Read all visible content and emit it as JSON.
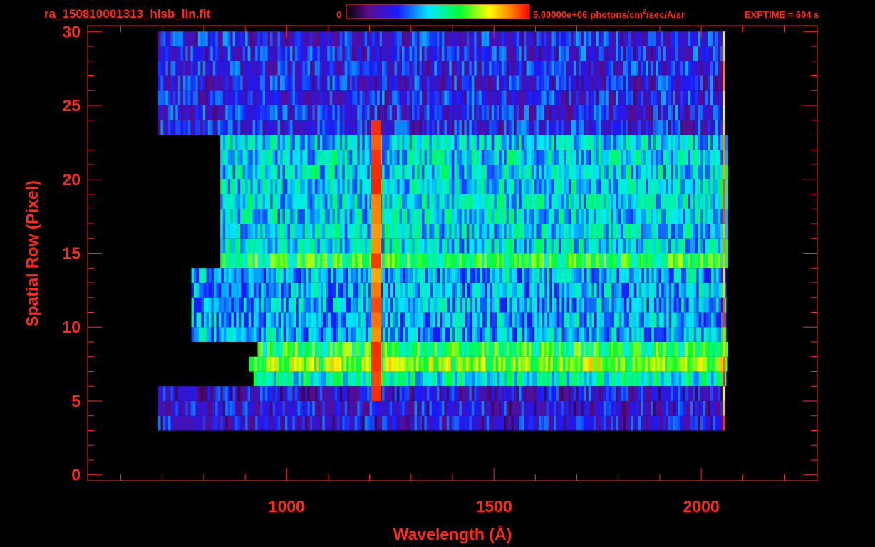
{
  "header": {
    "filename": "ra_150810001313_hisb_lin.fit",
    "colorbar_min": "0",
    "colorbar_max": "5.00000e+06",
    "units_pre": "photons/cm",
    "units_sup": "2",
    "units_post": "/sec/A/sr",
    "exptime": "EXPTIME = 604 s"
  },
  "chart_data": {
    "type": "heatmap",
    "xlabel": "Wavelength (Å)",
    "ylabel": "Spatial Row (Pixel)",
    "xlim": [
      520,
      2280
    ],
    "ylim": [
      -0.4,
      30.4
    ],
    "x_ticks": [
      1000,
      1500,
      2000
    ],
    "y_ticks": [
      0,
      5,
      10,
      15,
      20,
      25,
      30
    ],
    "colormap": "rainbow",
    "colors": {
      "axis": "#ff2a1a",
      "text": "#ff2a1a",
      "background": "#000000"
    },
    "bands": [
      {
        "y0": 23,
        "y1": 30,
        "x0": 690,
        "x1": 2055,
        "level": 0.25
      },
      {
        "y0": 15,
        "y1": 23,
        "x0": 840,
        "x1": 2060,
        "level": 0.45
      },
      {
        "y0": 14,
        "y1": 15,
        "x0": 840,
        "x1": 2060,
        "level": 0.6
      },
      {
        "y0": 9,
        "y1": 14,
        "x0": 770,
        "x1": 2060,
        "level": 0.4
      },
      {
        "y0": 8,
        "y1": 9,
        "x0": 930,
        "x1": 2060,
        "level": 0.6
      },
      {
        "y0": 7,
        "y1": 8,
        "x0": 910,
        "x1": 2060,
        "level": 0.7
      },
      {
        "y0": 6,
        "y1": 7,
        "x0": 920,
        "x1": 2060,
        "level": 0.5
      },
      {
        "y0": 3,
        "y1": 6,
        "x0": 690,
        "x1": 2055,
        "level": 0.22
      }
    ],
    "emission_line": {
      "x": 1216,
      "y0": 5,
      "y1": 24,
      "level": 0.92
    },
    "edge_line": {
      "x": 2055,
      "y0": 3,
      "y1": 30,
      "level": 0.88
    }
  }
}
